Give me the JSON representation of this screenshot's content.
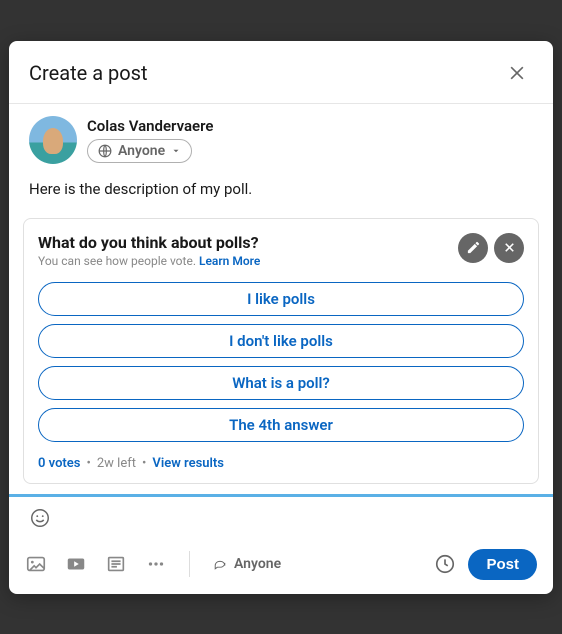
{
  "header": {
    "title": "Create a post"
  },
  "author": {
    "name": "Colas Vandervaere",
    "visibility_label": "Anyone"
  },
  "post_text": "Here is the description of my poll.",
  "poll": {
    "question": "What do you think about polls?",
    "subtext": "You can see how people vote.",
    "learn_more_label": "Learn More",
    "options": [
      "I like polls",
      "I don't like polls",
      "What is a poll?",
      "The 4th answer"
    ],
    "votes_label": "0 votes",
    "time_left": "2w left",
    "view_results_label": "View results"
  },
  "footer": {
    "share_label": "Anyone",
    "post_button": "Post"
  }
}
